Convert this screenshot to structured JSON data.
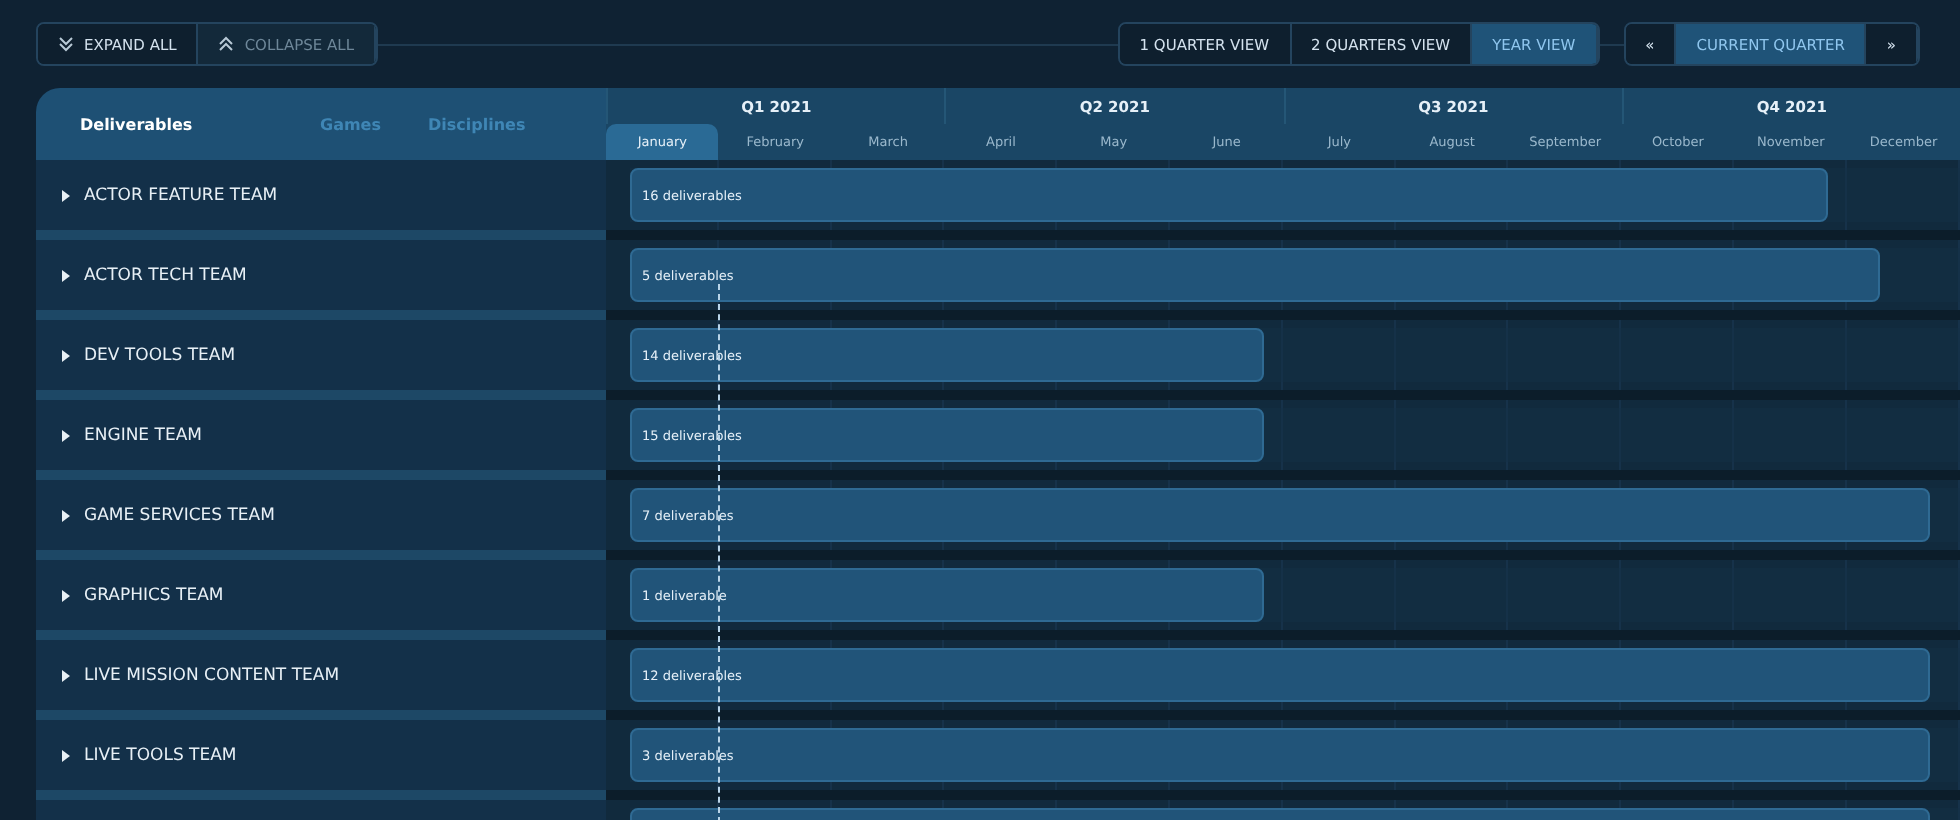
{
  "toolbar": {
    "buttons": [
      {
        "label": "EXPAND ALL",
        "disabled": false
      },
      {
        "label": "COLLAPSE ALL",
        "disabled": true
      }
    ]
  },
  "views": [
    {
      "label": "1 QUARTER VIEW",
      "selected": false
    },
    {
      "label": "2 QUARTERS VIEW",
      "selected": false
    },
    {
      "label": "YEAR VIEW",
      "selected": true
    }
  ],
  "navigation": {
    "previous": "«",
    "current": "CURRENT QUARTER",
    "next": "»"
  },
  "tabs": [
    {
      "label": "Deliverables",
      "selected": true
    },
    {
      "label": "Games",
      "selected": false
    },
    {
      "label": "Disciplines",
      "selected": false
    }
  ],
  "quarters": [
    "Q1 2021",
    "Q2 2021",
    "Q3 2021",
    "Q4 2021"
  ],
  "months": [
    {
      "label": "January",
      "selected": true
    },
    {
      "label": "February",
      "selected": false
    },
    {
      "label": "March",
      "selected": false
    },
    {
      "label": "April",
      "selected": false
    },
    {
      "label": "May",
      "selected": false
    },
    {
      "label": "June",
      "selected": false
    },
    {
      "label": "July",
      "selected": false
    },
    {
      "label": "August",
      "selected": false
    },
    {
      "label": "September",
      "selected": false
    },
    {
      "label": "October",
      "selected": false
    },
    {
      "label": "November",
      "selected": false
    },
    {
      "label": "December",
      "selected": false
    }
  ],
  "teams": [
    {
      "name": "ACTOR FEATURE TEAM",
      "expanded": false,
      "bar": "16 deliverables",
      "level": 0.9
    },
    {
      "name": "ACTOR TECH TEAM",
      "expanded": false,
      "bar": "5 deliverables",
      "level": 0.94
    },
    {
      "name": "DEV TOOLS TEAM",
      "expanded": false,
      "bar": "14 deliverables",
      "level": 0.477
    },
    {
      "name": "ENGINE TEAM",
      "expanded": false,
      "bar": "15 deliverables",
      "level": 0.477
    },
    {
      "name": "GAME SERVICES TEAM",
      "expanded": false,
      "bar": "7 deliverables",
      "level": 0.977
    },
    {
      "name": "GRAPHICS TEAM",
      "expanded": false,
      "bar": "1 deliverable",
      "level": 0.477
    },
    {
      "name": "LIVE MISSION CONTENT TEAM",
      "expanded": false,
      "bar": "12 deliverables",
      "level": 0.977
    },
    {
      "name": "LIVE TOOLS TEAM",
      "expanded": false,
      "bar": "3 deliverables",
      "level": 0.977
    },
    {
      "level": 0.977
    }
  ]
}
